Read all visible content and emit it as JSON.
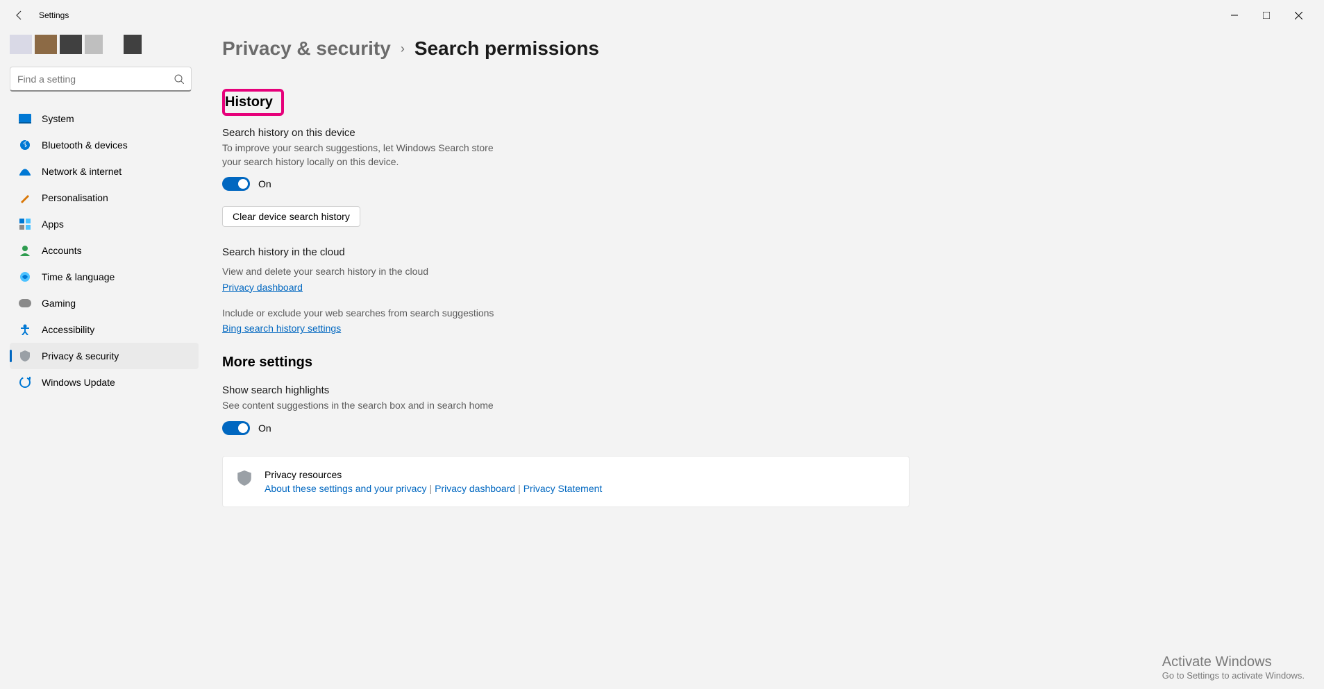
{
  "titlebar": {
    "app": "Settings"
  },
  "search": {
    "placeholder": "Find a setting"
  },
  "nav": {
    "system": "System",
    "bluetooth": "Bluetooth & devices",
    "network": "Network & internet",
    "personalisation": "Personalisation",
    "apps": "Apps",
    "accounts": "Accounts",
    "time": "Time & language",
    "gaming": "Gaming",
    "accessibility": "Accessibility",
    "privacy": "Privacy & security",
    "update": "Windows Update"
  },
  "crumb": {
    "parent": "Privacy & security",
    "current": "Search permissions"
  },
  "history": {
    "heading": "History",
    "device_title": "Search history on this device",
    "device_desc": "To improve your search suggestions, let Windows Search store your search history locally on this device.",
    "device_toggle": "On",
    "clear_btn": "Clear device search history",
    "cloud_title": "Search history in the cloud",
    "cloud_desc": "View and delete your search history in the cloud",
    "privacy_dashboard": "Privacy dashboard",
    "include_desc": "Include or exclude your web searches from search suggestions",
    "bing_link": "Bing search history settings"
  },
  "more": {
    "heading": "More settings",
    "highlights_title": "Show search highlights",
    "highlights_desc": "See content suggestions in the search box and in search home",
    "highlights_toggle": "On"
  },
  "resources": {
    "title": "Privacy resources",
    "link1": "About these settings and your privacy",
    "link2": "Privacy dashboard",
    "link3": "Privacy Statement"
  },
  "watermark": {
    "line1": "Activate Windows",
    "line2": "Go to Settings to activate Windows."
  }
}
